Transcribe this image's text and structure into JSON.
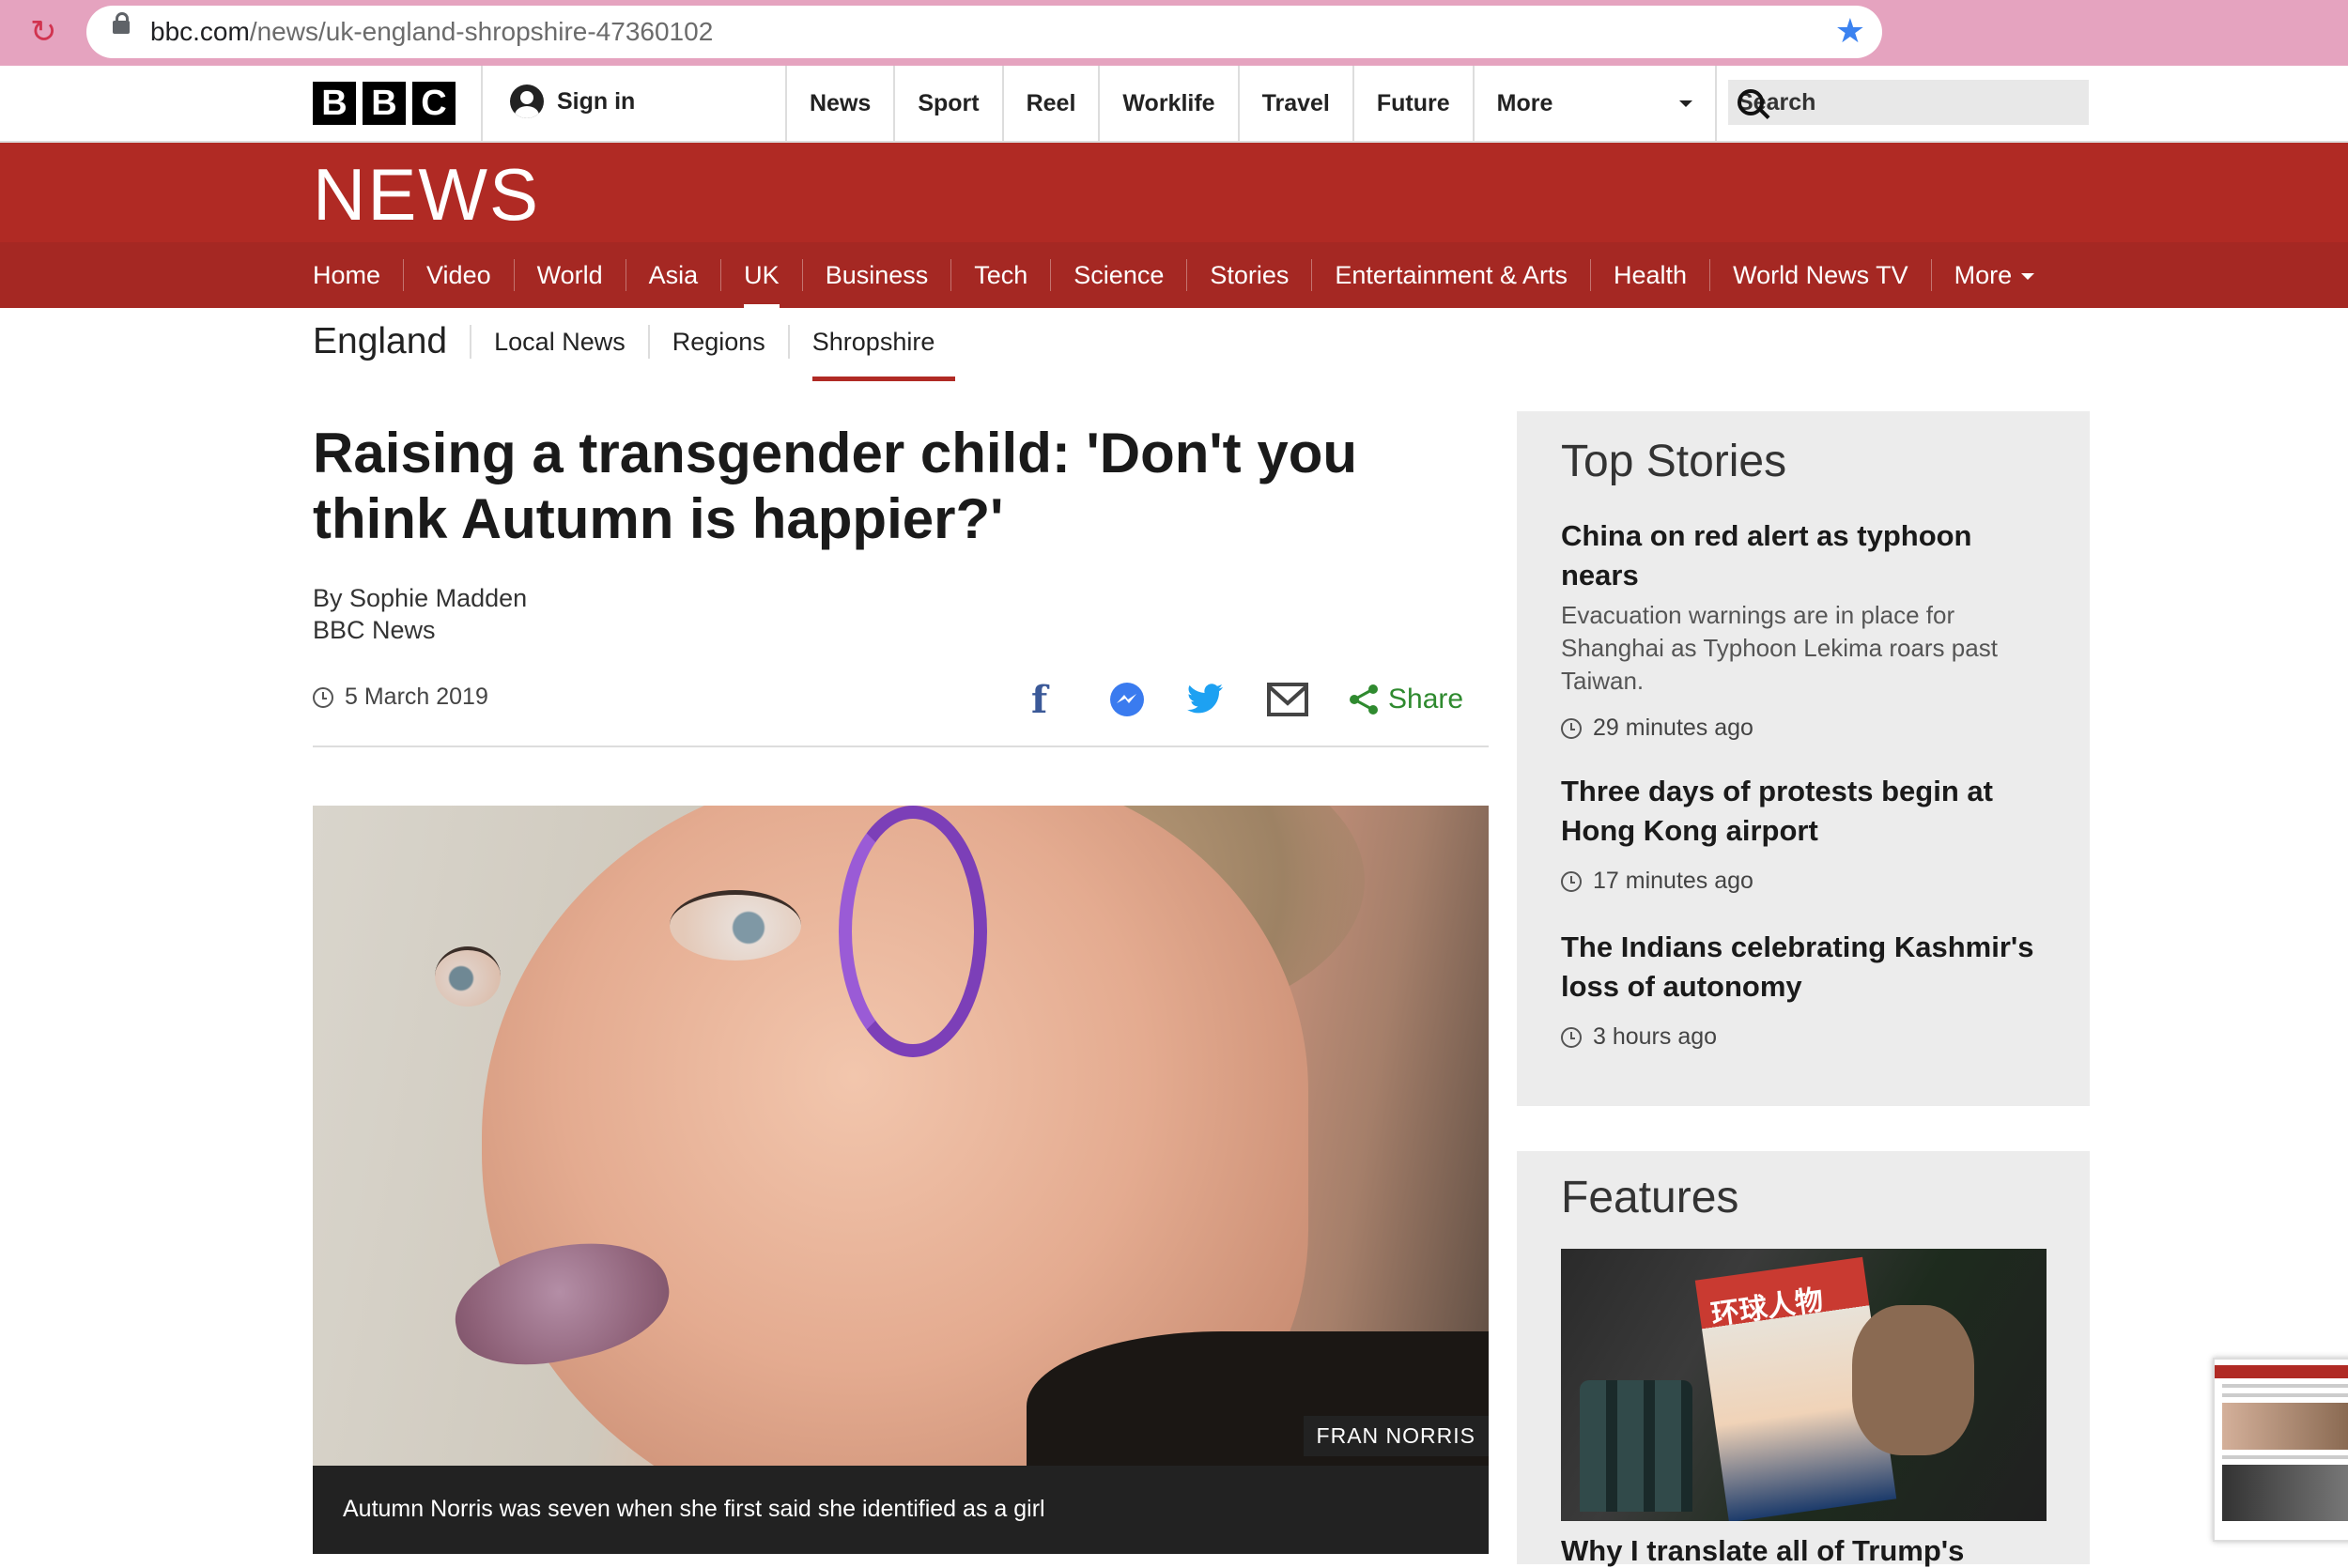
{
  "browser": {
    "url_domain": "bbc.com",
    "url_path": "/news/uk-england-shropshire-47360102"
  },
  "topbar": {
    "logo_letters": [
      "B",
      "B",
      "C"
    ],
    "sign_in": "Sign in",
    "nav": [
      "News",
      "Sport",
      "Reel",
      "Worklife",
      "Travel",
      "Future"
    ],
    "more": "More",
    "search_placeholder": "Search"
  },
  "news_band": {
    "wordmark": "NEWS",
    "nav": [
      "Home",
      "Video",
      "World",
      "Asia",
      "UK",
      "Business",
      "Tech",
      "Science",
      "Stories",
      "Entertainment & Arts",
      "Health",
      "World News TV"
    ],
    "active": "UK",
    "more": "More"
  },
  "subnav": {
    "region": "England",
    "items": [
      "Local News",
      "Regions",
      "Shropshire"
    ],
    "active": "Shropshire"
  },
  "article": {
    "headline": "Raising a transgender child: 'Don't you think Autumn is happier?'",
    "author": "By Sophie Madden",
    "outlet": "BBC News",
    "date": "5 March 2019",
    "share_label": "Share",
    "photo_credit": "FRAN NORRIS",
    "caption": "Autumn Norris was seven when she first said she identified as a girl"
  },
  "sidebar": {
    "top_stories_title": "Top Stories",
    "stories": [
      {
        "title": "China on red alert as typhoon nears",
        "summary": "Evacuation warnings are in place for Shanghai as Typhoon Lekima roars past Taiwan.",
        "time": "29 minutes ago"
      },
      {
        "title": "Three days of protests begin at Hong Kong airport",
        "summary": "",
        "time": "17 minutes ago"
      },
      {
        "title": "The Indians celebrating Kashmir's loss of autonomy",
        "summary": "",
        "time": "3 hours ago"
      }
    ],
    "features_title": "Features",
    "feature_title": "Why I translate all of Trump's",
    "feature_magazine_text": "环球人物"
  },
  "colors": {
    "bbc_red": "#b02a24",
    "share_green": "#2f8a2f",
    "facebook_blue": "#3b5998",
    "twitter_blue": "#1da1f2",
    "browser_bar": "#e5a3bf"
  }
}
